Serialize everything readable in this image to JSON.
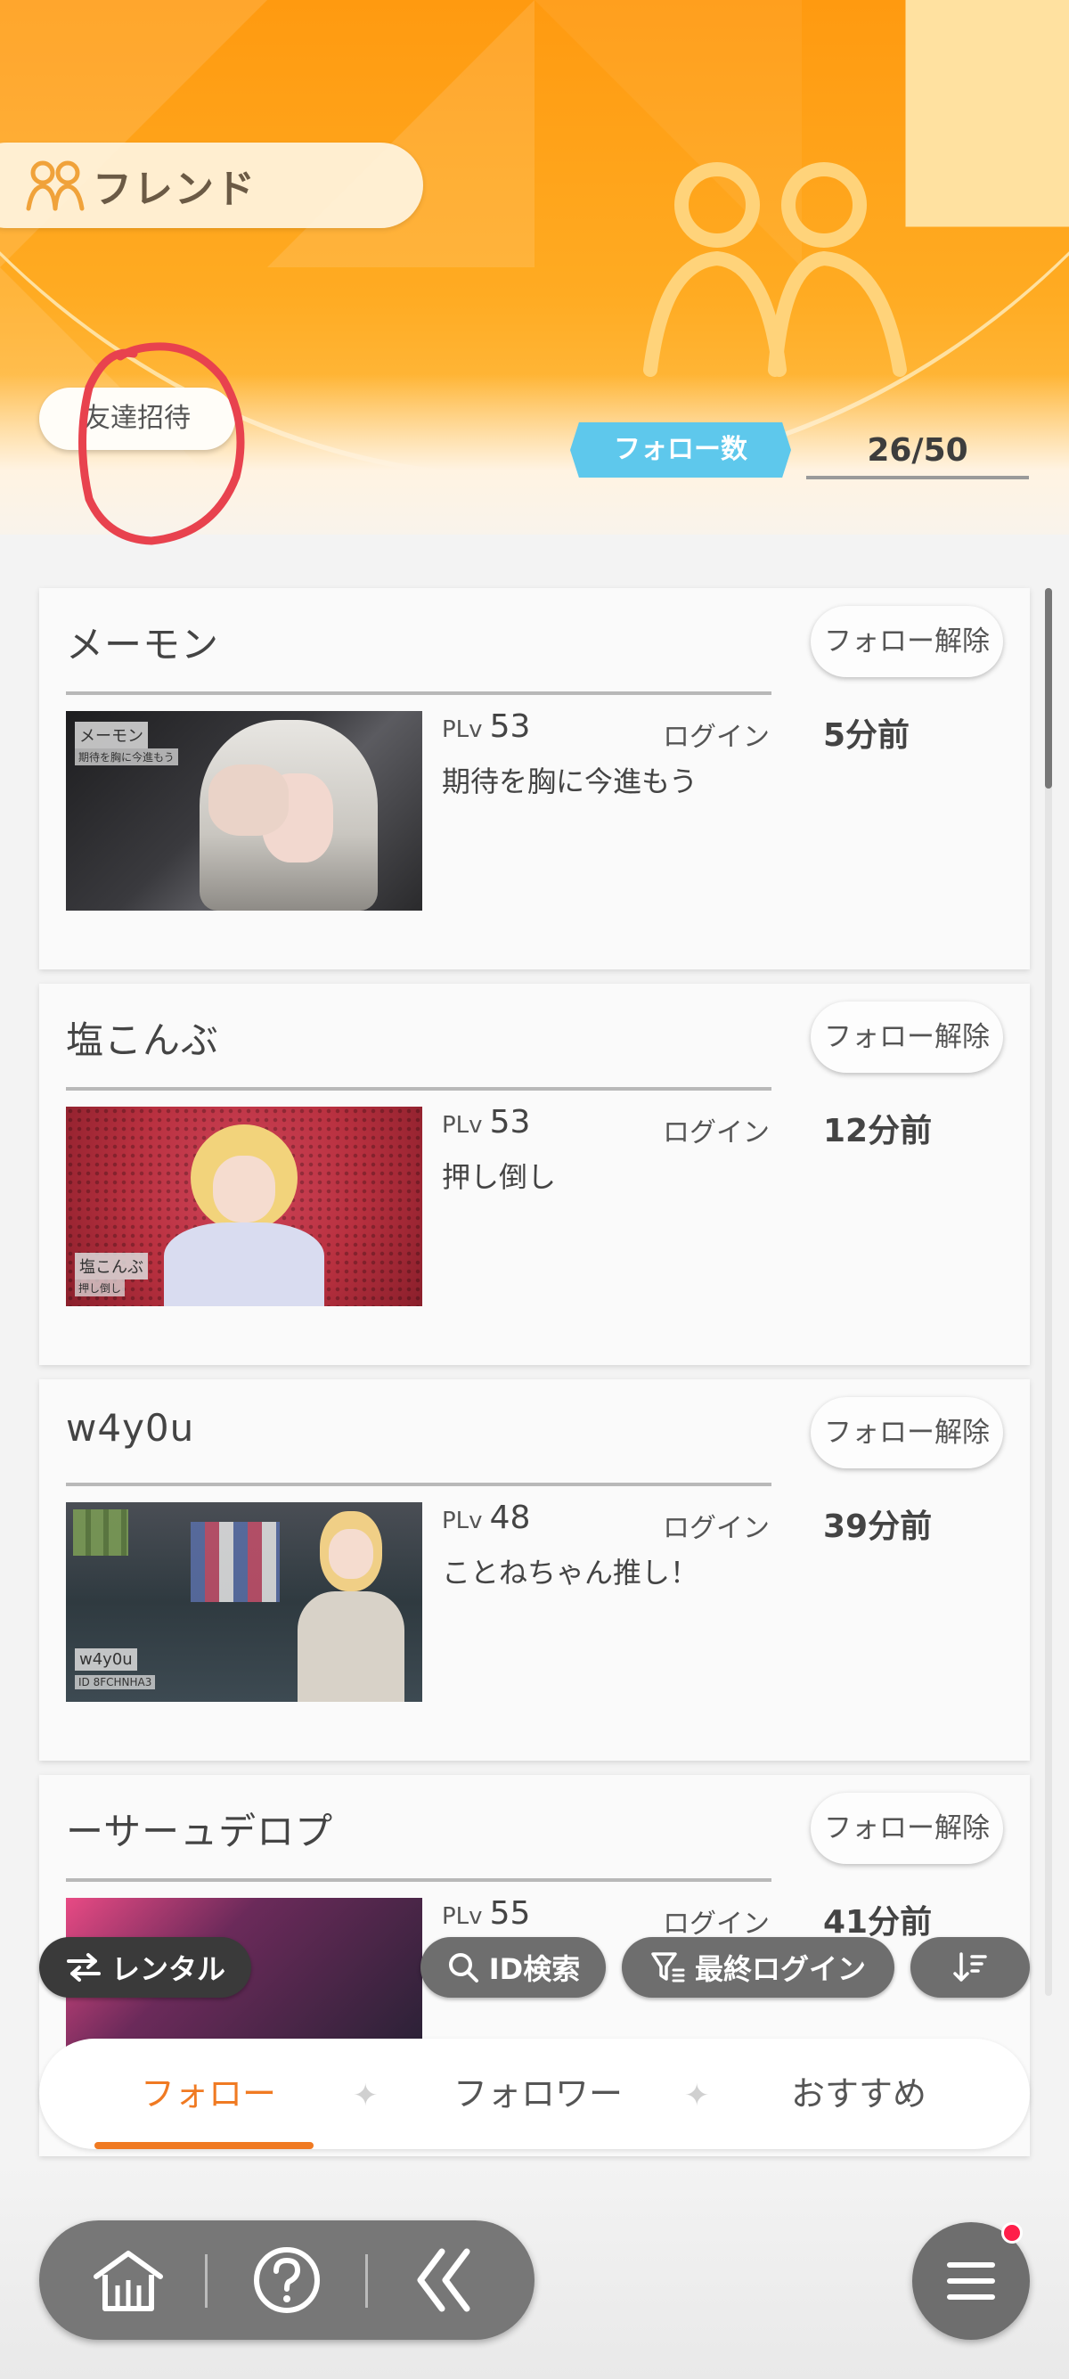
{
  "header": {
    "title": "フレンド",
    "invite_button": "友達招待",
    "follow_count_label": "フォロー数",
    "follow_count": "26/50"
  },
  "friends": [
    {
      "name": "メーモン",
      "unfollow": "フォロー解除",
      "plv_label": "PLv",
      "plv": "53",
      "login_label": "ログイン",
      "last_login": "5分前",
      "message": "期待を胸に今進もう",
      "thumb_name": "メーモン",
      "thumb_sub": "期待を胸に今進もう"
    },
    {
      "name": "塩こんぶ",
      "unfollow": "フォロー解除",
      "plv_label": "PLv",
      "plv": "53",
      "login_label": "ログイン",
      "last_login": "12分前",
      "message": "押し倒し",
      "thumb_name": "塩こんぶ",
      "thumb_sub": "押し倒し"
    },
    {
      "name": "w4y0u",
      "unfollow": "フォロー解除",
      "plv_label": "PLv",
      "plv": "48",
      "login_label": "ログイン",
      "last_login": "39分前",
      "message": "ことねちゃん推し！",
      "thumb_name": "w4y0u",
      "thumb_sub": "ID 8FCHNHA3"
    },
    {
      "name": "ーサーュデロプ",
      "unfollow": "フォロー解除",
      "plv_label": "PLv",
      "plv": "55",
      "login_label": "ログイン",
      "last_login": "41分前",
      "message": "",
      "thumb_name": "",
      "thumb_sub": ""
    }
  ],
  "filters": {
    "rental": "レンタル",
    "id_search": "ID検索",
    "last_login": "最終ログイン",
    "sort_icon": "sort-icon"
  },
  "tabs": {
    "follow": "フォロー",
    "follower": "フォロワー",
    "recommended": "おすすめ",
    "active": "follow"
  },
  "nav": {
    "icons": [
      "home-icon",
      "help-icon",
      "back-icon",
      "menu-icon"
    ],
    "notification": true
  },
  "colors": {
    "accent": "#f07a22",
    "header": "#ff9a10",
    "follow_label": "#5ec8ec",
    "badge": "#ff1f4a"
  }
}
